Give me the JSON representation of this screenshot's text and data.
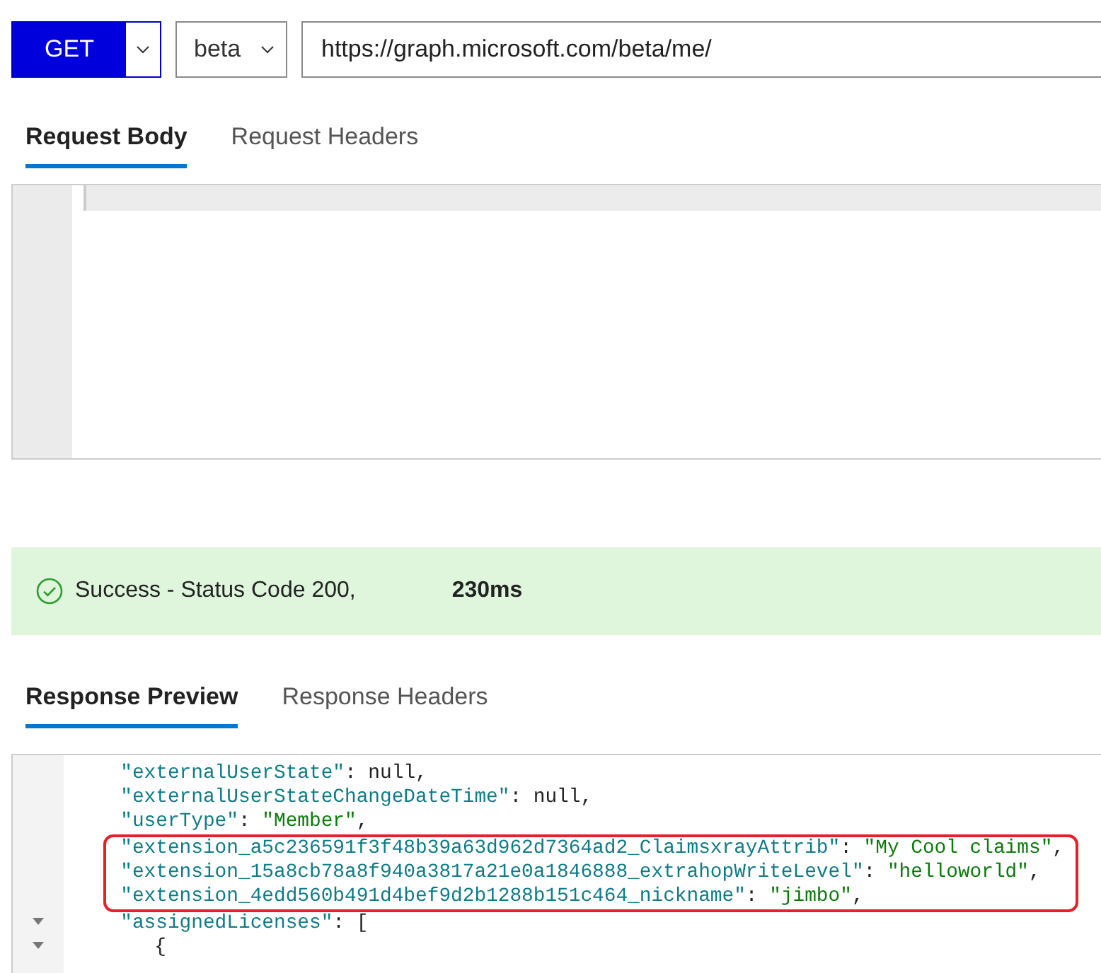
{
  "request": {
    "method": "GET",
    "version": "beta",
    "url": "https://graph.microsoft.com/beta/me/"
  },
  "request_tabs": [
    {
      "label": "Request Body",
      "selected": true
    },
    {
      "label": "Request Headers",
      "selected": false
    }
  ],
  "status": {
    "kind": "success",
    "message": "Success - Status Code 200,",
    "duration": "230ms"
  },
  "response_tabs": [
    {
      "label": "Response Preview",
      "selected": true
    },
    {
      "label": "Response Headers",
      "selected": false
    }
  ],
  "response_blocks": [
    {
      "kind": "plain",
      "lines": [
        {
          "parts": [
            {
              "kind": "key",
              "text": "\"externalUserState\""
            },
            {
              "kind": "punct",
              "text": ": null,"
            }
          ]
        },
        {
          "parts": [
            {
              "kind": "key",
              "text": "\"externalUserStateChangeDateTime\""
            },
            {
              "kind": "punct",
              "text": ": null,"
            }
          ]
        },
        {
          "parts": [
            {
              "kind": "key",
              "text": "\"userType\""
            },
            {
              "kind": "punct",
              "text": ": "
            },
            {
              "kind": "string",
              "text": "\"Member\""
            },
            {
              "kind": "punct",
              "text": ","
            }
          ]
        }
      ]
    },
    {
      "kind": "highlight",
      "lines": [
        {
          "parts": [
            {
              "kind": "key",
              "text": "\"extension_a5c236591f3f48b39a63d962d7364ad2_ClaimsxrayAttrib\""
            },
            {
              "kind": "punct",
              "text": ": "
            },
            {
              "kind": "string",
              "text": "\"My Cool claims\""
            },
            {
              "kind": "punct",
              "text": ","
            }
          ]
        },
        {
          "parts": [
            {
              "kind": "key",
              "text": "\"extension_15a8cb78a8f940a3817a21e0a1846888_extrahopWriteLevel\""
            },
            {
              "kind": "punct",
              "text": ": "
            },
            {
              "kind": "string",
              "text": "\"helloworld\""
            },
            {
              "kind": "punct",
              "text": ","
            }
          ]
        },
        {
          "parts": [
            {
              "kind": "key",
              "text": "\"extension_4edd560b491d4bef9d2b1288b151c464_nickname\""
            },
            {
              "kind": "punct",
              "text": ": "
            },
            {
              "kind": "string",
              "text": "\"jimbo\""
            },
            {
              "kind": "punct",
              "text": ","
            }
          ]
        }
      ]
    },
    {
      "kind": "plain",
      "lines": [
        {
          "foldable": true,
          "parts": [
            {
              "kind": "key",
              "text": "\"assignedLicenses\""
            },
            {
              "kind": "punct",
              "text": ": ["
            }
          ],
          "children": [
            {
              "foldable": true,
              "parts": [
                {
                  "kind": "punct",
                  "text": "{"
                }
              ]
            }
          ]
        }
      ]
    }
  ]
}
